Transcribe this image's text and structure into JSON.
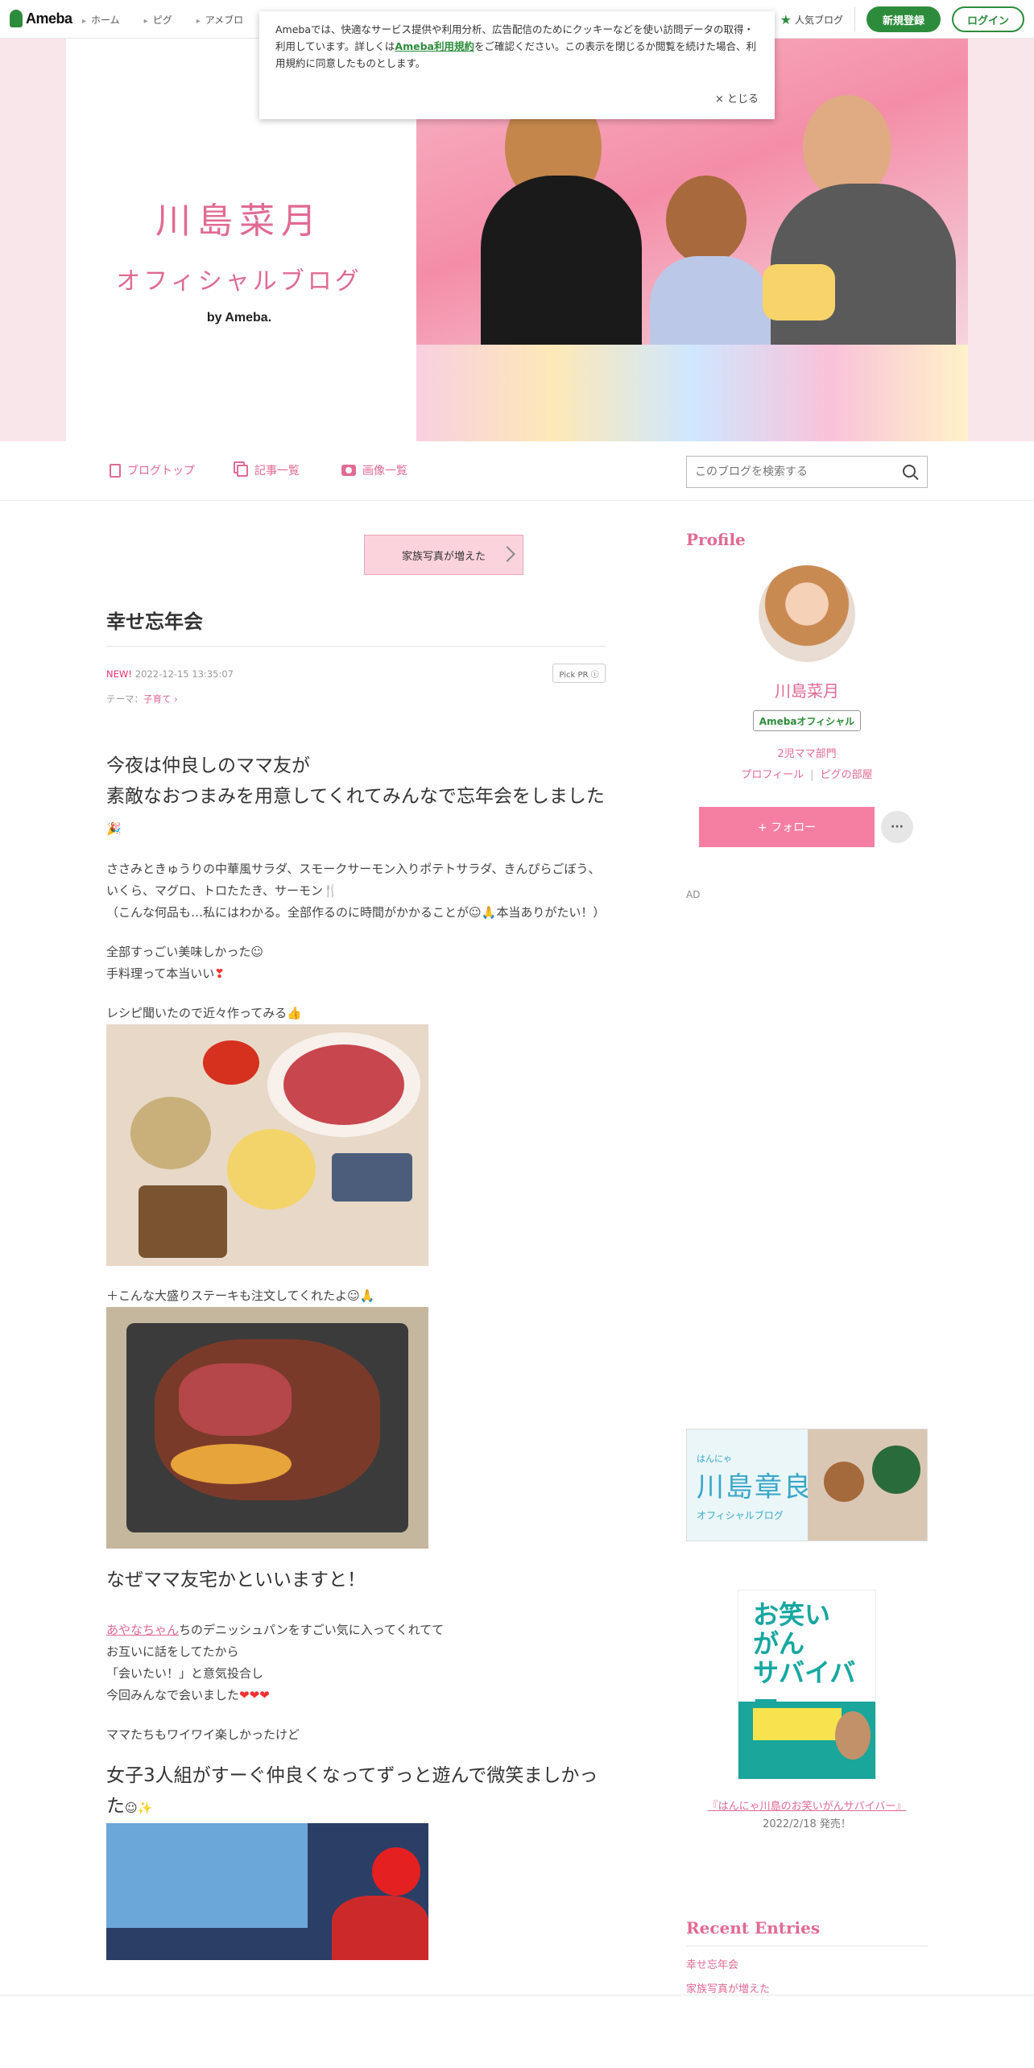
{
  "header": {
    "logo": "Ameba",
    "nav": [
      "ホーム",
      "ピグ",
      "アメブロ"
    ],
    "popular": "人気ブログ",
    "register": "新規登録",
    "login": "ログイン"
  },
  "cookie": {
    "text_before": "Amebaでは、快適なサービス提供や利用分析、広告配信のためにクッキーなどを使い訪問データの取得・利用しています。詳しくは",
    "link": "Ameba利用規約",
    "text_after": "をご確認ください。この表示を閉じるか閲覧を続けた場合、利用規約に同意したものとします。",
    "close": "× とじる"
  },
  "banner": {
    "title": "川島菜月",
    "subtitle": "オフィシャルブログ",
    "by": "by Ameba."
  },
  "blognav": {
    "items": [
      "ブログトップ",
      "記事一覧",
      "画像一覧"
    ],
    "search_placeholder": "このブログを検索する"
  },
  "article": {
    "notice": "家族写真が増えた",
    "title": "幸せ忘年会",
    "new": "NEW!",
    "datetime": "2022-12-15 13:35:07",
    "pickpr": "Pick PR ⓘ",
    "theme_label": "テーマ：",
    "theme": "子育て",
    "p1a": "今夜は仲良しのママ友が",
    "p1b": "素敵なおつまみを用意してくれてみんなで忘年会をしました",
    "p2": "ささみときゅうりの中華風サラダ、スモークサーモン入りポテトサラダ、きんぴらごぼう、いくら、マグロ、トロたたき、サーモン",
    "p3a": "（こんな何品も…私にはわかる。全部作るのに時間がかかることが",
    "p3b": "本当ありがたい！）",
    "p4": "全部すっごい美味しかった",
    "p5": "手料理って本当いい",
    "p6": "レシピ聞いたので近々作ってみる",
    "p7": "＋こんな大盛りステーキも注文してくれたよ",
    "p8": "なぜママ友宅かといいますと！",
    "p9_link": "あやなちゃん",
    "p9": "ちのデニッシュパンをすごい気に入ってくれてて",
    "p10": "お互いに話をしてたから",
    "p11": "「会いたい！」と意気投合し",
    "p12": "今回みんなで会いました",
    "p13": "ママたちもワイワイ楽しかったけど",
    "p14": "女子3人組がすーぐ仲良くなってずっと遊んで微笑ましかった"
  },
  "sidebar": {
    "profile": "Profile",
    "name": "川島菜月",
    "badge": "Amebaオフィシャル",
    "category": "2児ママ部門",
    "profile_link": "プロフィール",
    "room_link": "ピグの部屋",
    "follow": "+ フォロー",
    "more": "···",
    "ad": "AD",
    "banner_small": "はんにゃ",
    "banner_name": "川島章良",
    "banner_sub": "オフィシャルブログ",
    "book_title": "お笑い\nがん\nサバイバー",
    "book_caption": "『はんにゃ川島のお笑いがんサバイバー』",
    "book_date": "2022/2/18 発売！",
    "recent": "Recent Entries",
    "recent_items": [
      "幸せ忘年会",
      "家族写真が増えた"
    ]
  }
}
